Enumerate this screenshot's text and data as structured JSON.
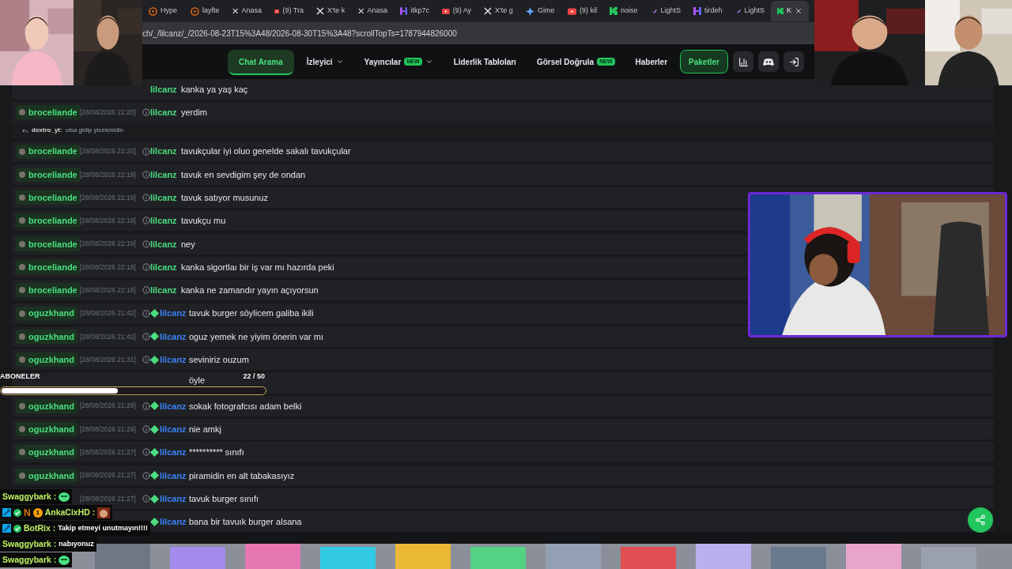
{
  "browser": {
    "tabs": [
      {
        "label": "Hype",
        "kind": "orange",
        "selected": false
      },
      {
        "label": "layfte",
        "kind": "orange",
        "selected": false
      },
      {
        "label": "Anasa",
        "kind": "x",
        "selected": false
      },
      {
        "label": "(9) Tra",
        "kind": "youtube",
        "selected": false
      },
      {
        "label": "X'te k",
        "kind": "x",
        "selected": false
      },
      {
        "label": "Anasa",
        "kind": "x",
        "selected": false
      },
      {
        "label": "itkp7c",
        "kind": "purple",
        "selected": false
      },
      {
        "label": "(9) Ay",
        "kind": "youtube",
        "selected": false
      },
      {
        "label": "X'te g",
        "kind": "x",
        "selected": false
      },
      {
        "label": "Gime",
        "kind": "blue",
        "selected": false
      },
      {
        "label": "(9) kil",
        "kind": "youtube",
        "selected": false
      },
      {
        "label": "noise",
        "kind": "kick",
        "selected": false
      },
      {
        "label": "LightS",
        "kind": "feather",
        "selected": false
      },
      {
        "label": "tirdeh",
        "kind": "purple",
        "selected": false
      },
      {
        "label": "LightS",
        "kind": "feather",
        "selected": false
      },
      {
        "label": "K",
        "kind": "kick",
        "selected": true
      }
    ],
    "address": "ch/_/lilcanz/_/2026-08-23T15%3A48/2026-08-30T15%3A48?scrollTopTs=1787944826000"
  },
  "nav": {
    "items": [
      {
        "label": "Chat Arama",
        "selected": true,
        "dropdown": false
      },
      {
        "label": "İzleyici",
        "selected": false,
        "dropdown": true
      },
      {
        "label": "Yayıncılar",
        "selected": false,
        "dropdown": true,
        "badge": "NEW"
      },
      {
        "label": "Liderlik Tabloları",
        "selected": false,
        "dropdown": false
      },
      {
        "label": "Görsel Doğrula",
        "selected": false,
        "dropdown": false,
        "badge": "NEW"
      },
      {
        "label": "Haberler",
        "selected": false,
        "dropdown": false
      }
    ],
    "cta": "Paketler"
  },
  "chat": {
    "messages": [
      {
        "subscriber": false,
        "recipient": "lilcanz",
        "text": "kanka ya yaş kaç"
      },
      {
        "user": "broceliande",
        "time": "[28/08/2026 22:20]",
        "subscriber": false,
        "recipient": "lilcanz",
        "text": "yerdim",
        "reply": {
          "user": "dextro_yt:",
          "text": "olsa gidip yicekmidin"
        }
      },
      {
        "user": "broceliande",
        "time": "[28/08/2026 22:20]",
        "subscriber": false,
        "recipient": "lilcanz",
        "text": "tavukçular iyi oluo genelde sakalı tavukçular"
      },
      {
        "user": "broceliande",
        "time": "[28/08/2026 22:19]",
        "subscriber": false,
        "recipient": "lilcanz",
        "text": "tavuk en sevdigim şey de ondan"
      },
      {
        "user": "broceliande",
        "time": "[28/08/2026 22:19]",
        "subscriber": false,
        "recipient": "lilcanz",
        "text": "tavuk satıyor musunuz"
      },
      {
        "user": "broceliande",
        "time": "[28/08/2026 22:19]",
        "subscriber": false,
        "recipient": "lilcanz",
        "text": "tavukçu mu"
      },
      {
        "user": "broceliande",
        "time": "[28/08/2026 22:19]",
        "subscriber": false,
        "recipient": "lilcanz",
        "text": "ney"
      },
      {
        "user": "broceliande",
        "time": "[28/08/2026 22:18]",
        "subscriber": false,
        "recipient": "lilcanz",
        "text": "kanka sigortlaı bir iş var mı hazırda peki"
      },
      {
        "user": "broceliande",
        "time": "[28/08/2026 22:18]",
        "subscriber": false,
        "recipient": "lilcanz",
        "text": "kanka ne zamandır yayın açıyorsun"
      },
      {
        "user": "oguzkhand",
        "time": "[28/08/2026 21:42]",
        "subscriber": true,
        "recipient": "lilcanz",
        "text": "tavuk burger söylicem galiba ikili"
      },
      {
        "user": "oguzkhand",
        "time": "[28/08/2026 21:42]",
        "subscriber": true,
        "recipient": "lilcanz",
        "text": "oguz yemek ne yiyim önerin var mı"
      },
      {
        "user": "oguzkhand",
        "time": "[28/08/2026 21:31]",
        "subscriber": true,
        "recipient": "lilcanz",
        "text": "seviniriz ouzum"
      },
      {
        "subscriber": true,
        "text": "öyle"
      },
      {
        "user": "oguzkhand",
        "time": "[28/08/2026 21:29]",
        "subscriber": true,
        "recipient": "lilcanz",
        "text": "sokak fotografcısı adam belki"
      },
      {
        "user": "oguzkhand",
        "time": "[28/08/2026 21:29]",
        "subscriber": true,
        "recipient": "lilcanz",
        "text": "nie amkj"
      },
      {
        "user": "oguzkhand",
        "time": "[28/08/2026 21:27]",
        "subscriber": true,
        "recipient": "lilcanz",
        "text": "********** sınıfı"
      },
      {
        "user": "oguzkhand",
        "time": "[28/08/2026 21:27]",
        "subscriber": true,
        "recipient": "lilcanz",
        "text": "piramidin en alt tabakasıyız"
      },
      {
        "time": "[28/08/2026 21:27]",
        "subscriber": true,
        "recipient": "lilcanz",
        "text": "tavuk burger sınıfı"
      },
      {
        "subscriber": true,
        "recipient": "lilcanz",
        "text": "bana bir tavuık burger alsana"
      }
    ]
  },
  "overlay": {
    "goal": {
      "label": "ABONELER",
      "count": "22 / 50",
      "level": 0.44
    },
    "stream_chat": [
      {
        "kind": "blob",
        "user": "Swaggybark :"
      },
      {
        "user": "AnkaCixHD :",
        "moderator": true,
        "verified": true,
        "rank": {
          "letter": "N",
          "number": "1"
        }
      },
      {
        "kind": "text",
        "user": "BotRix :",
        "moderator": true,
        "verified": true,
        "text": "Takip etmeyi unutmayın!!!!"
      },
      {
        "kind": "text",
        "user": "Swaggybark :",
        "text": "nabıyonuz"
      },
      {
        "kind": "blob",
        "user": "Swaggybark :"
      }
    ]
  }
}
